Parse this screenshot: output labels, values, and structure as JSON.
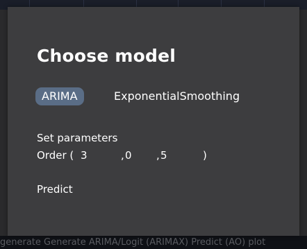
{
  "dialog": {
    "title": "Choose model",
    "models": [
      {
        "label": "ARIMA",
        "selected": true
      },
      {
        "label": "ExponentialSmoothing",
        "selected": false
      }
    ],
    "parameters_label": "Set parameters",
    "order": {
      "label": "Order (",
      "p": "3",
      "sep1": ",",
      "d": "0",
      "sep2": ",",
      "q": "5",
      "close": ")"
    },
    "predict_label": "Predict"
  },
  "background": {
    "partial_text": "generate     Generate ARIMA/Logit (ARIMAX) Predict (AO) plot"
  },
  "colors": {
    "panel_bg": "#3d3d3f",
    "selected_tab_bg": "#5a6d86",
    "text": "#ffffff"
  }
}
